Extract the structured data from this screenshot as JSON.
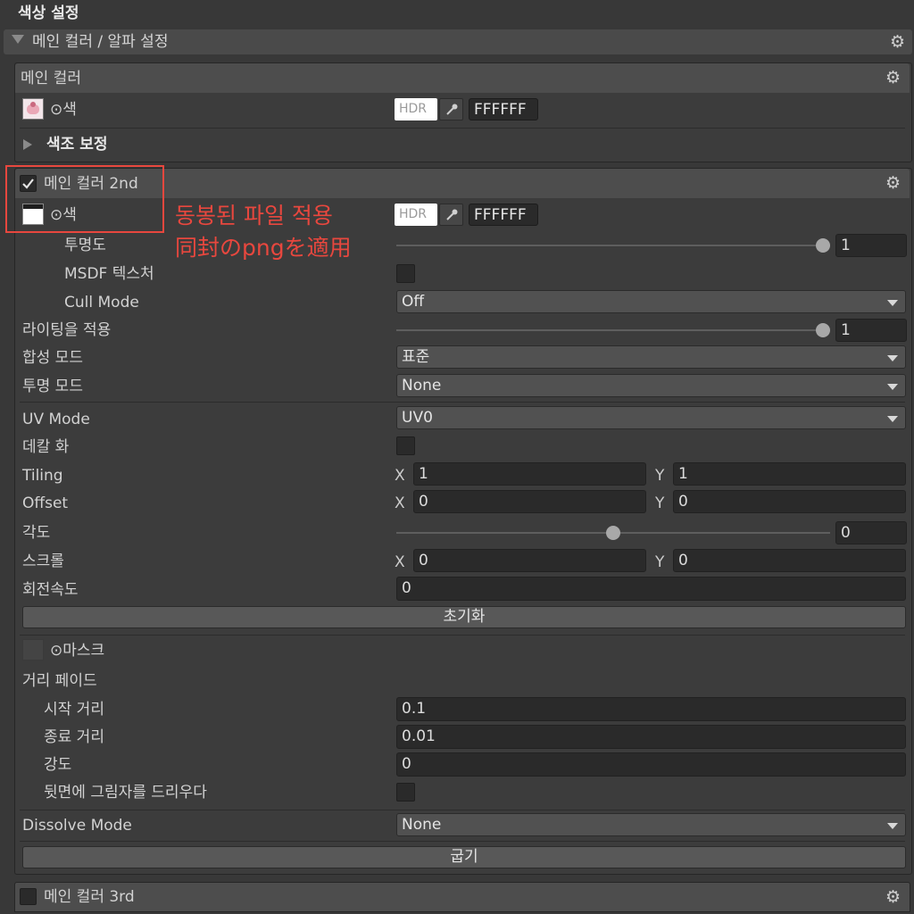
{
  "header": {
    "title": "색상 설정"
  },
  "section": {
    "title": "메인 컬러 / 알파 설정"
  },
  "main_color": {
    "title": "메인 컬러",
    "color_label": "⊙색",
    "hdr": "HDR",
    "hex": "FFFFFF",
    "tone_label": "색조 보정"
  },
  "main_color_2nd": {
    "title": "메인 컬러 2nd",
    "enabled": true,
    "color_label": "⊙색",
    "hdr": "HDR",
    "hex": "FFFFFF",
    "transparency_label": "투명도",
    "transparency_value": "1",
    "transparency_level": 1.0,
    "msdf_label": "MSDF 텍스처",
    "cull_label": "Cull Mode",
    "cull_value": "Off",
    "lighting_label": "라이팅을 적용",
    "lighting_value": "1",
    "lighting_level": 1.0,
    "blend_label": "합성 모드",
    "blend_value": "표준",
    "alpha_label": "투명 모드",
    "alpha_value": "None",
    "uv_label": "UV Mode",
    "uv_value": "UV0",
    "decal_label": "데칼 화",
    "tiling_label": "Tiling",
    "tiling_x": "1",
    "tiling_y": "1",
    "offset_label": "Offset",
    "offset_x": "0",
    "offset_y": "0",
    "angle_label": "각도",
    "angle_value": "0",
    "angle_level": 0.5,
    "scroll_label": "스크롤",
    "scroll_x": "0",
    "scroll_y": "0",
    "rotation_label": "회전속도",
    "rotation_value": "0",
    "reset_label": "초기화",
    "mask_label": "⊙마스크",
    "fade_label": "거리 페이드",
    "fade_start_label": "시작 거리",
    "fade_start_value": "0.1",
    "fade_end_label": "종료 거리",
    "fade_end_value": "0.01",
    "fade_strength_label": "강도",
    "fade_strength_value": "0",
    "backface_label": "뒷면에 그림자를 드리우다",
    "dissolve_label": "Dissolve Mode",
    "dissolve_value": "None",
    "bake_label": "굽기"
  },
  "main_color_3rd": {
    "title": "메인 컬러 3rd",
    "enabled": false
  },
  "axis": {
    "x": "X",
    "y": "Y"
  },
  "annotation": {
    "line1": "동봉된 파일 적용",
    "line2": "同封のpngを適用",
    "color": "#e8473e"
  },
  "icons": [
    "gear-icon",
    "foldout-down-icon",
    "foldout-right-icon",
    "checkmark-icon",
    "eyedropper-icon",
    "dropdown-caret-icon"
  ]
}
